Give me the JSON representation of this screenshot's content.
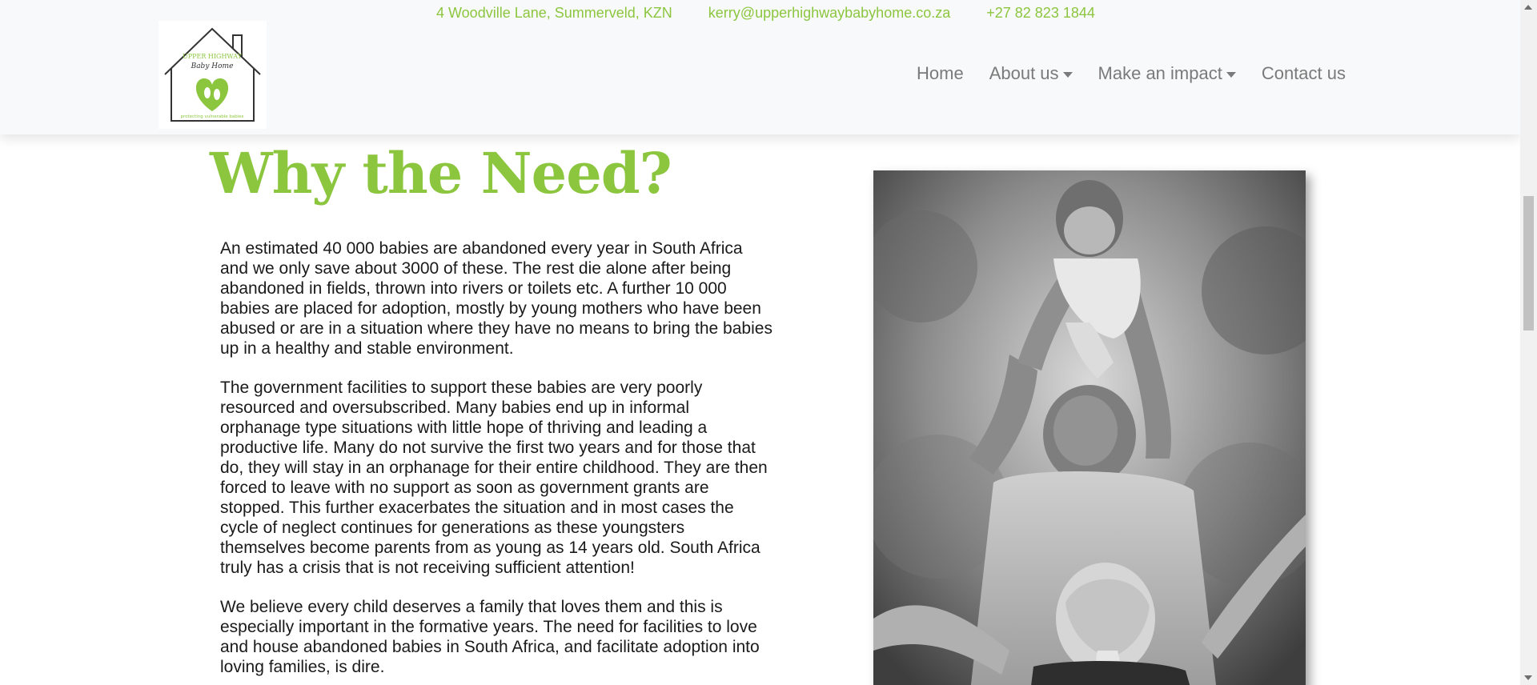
{
  "topbar": {
    "address": "4 Woodville Lane, Summerveld, KZN",
    "email": "kerry@upperhighwaybabyhome.co.za",
    "phone": "+27 82 823 1844"
  },
  "logo": {
    "line1": "UPPER HIGHWAY",
    "line2": "Baby Home",
    "tagline": "protecting vulnerable babies"
  },
  "nav": {
    "home": "Home",
    "about": "About us",
    "impact": "Make an impact",
    "contact": "Contact us"
  },
  "page": {
    "heading": "Why the Need?",
    "paragraphs": [
      "An estimated 40 000 babies are abandoned every year in South Africa and we only save about 3000 of these. The rest die alone after being abandoned in fields, thrown into rivers or toilets etc. A further 10 000 babies are placed for adoption, mostly by young mothers who have been abused or are in a situation where they have no means to bring the babies up in a healthy and stable environment.",
      "The government facilities to support these babies are very poorly resourced and oversubscribed. Many babies end up in informal orphanage type situations with little hope of thriving and leading a productive life. Many do not survive the first two years and for those that do, they will stay in an orphanage for their entire childhood. They are then forced to leave with no support as soon as government grants are stopped. This further exacerbates the situation and in most cases the cycle of neglect continues for generations as these youngsters themselves become parents from as young as 14 years old. South Africa truly has a crisis that is not receiving sufficient attention!",
      "We believe every child deserves a family that loves them and this is especially important in the formative years. The need for facilities to love and house abandoned babies in South Africa, and facilitate adoption into loving families, is dire."
    ]
  },
  "colors": {
    "brand_green": "#8cc63f",
    "nav_text": "#7a7a7a",
    "header_bg": "#f8f9fa"
  },
  "icons": {
    "logo": "house-heart-footprints-logo",
    "dropdown": "caret-down-icon"
  }
}
